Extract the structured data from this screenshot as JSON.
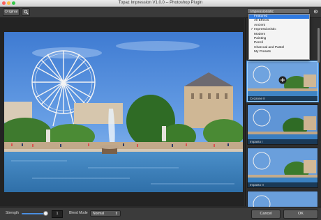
{
  "window": {
    "title": "Topaz Impression V1.0.0 -- Photoshop Plugin"
  },
  "toolbar": {
    "original_label": "Original",
    "zoom_icon": "magnifier-icon"
  },
  "dropdown": {
    "selected": "Impressionistic",
    "items": [
      {
        "label": "Featured",
        "highlighted": true,
        "checked": false
      },
      {
        "label": "All Effects",
        "highlighted": false,
        "checked": false
      },
      {
        "label": "Ancient",
        "highlighted": false,
        "checked": false
      },
      {
        "label": "Impressionistic",
        "highlighted": false,
        "checked": true
      },
      {
        "label": "Modern",
        "highlighted": false,
        "checked": false
      },
      {
        "label": "Painting",
        "highlighted": false,
        "checked": false
      },
      {
        "label": "Pencil",
        "highlighted": false,
        "checked": false
      },
      {
        "label": "Charcoal and Pastel",
        "highlighted": false,
        "checked": false
      },
      {
        "label": "My Presets",
        "highlighted": false,
        "checked": false
      }
    ]
  },
  "presets": [
    {
      "label": "Cezanne II",
      "selected": true
    },
    {
      "label": "Impasto I",
      "selected": false
    },
    {
      "label": "Impasto II",
      "selected": false
    },
    {
      "label": "",
      "selected": false
    }
  ],
  "bottom": {
    "strength_label": "Strength",
    "strength_value": "1",
    "strength_fraction": 0.85,
    "blend_mode_label": "Blend Mode",
    "blend_mode_value": "Normal",
    "cancel_label": "Cancel",
    "ok_label": "OK"
  },
  "colors": {
    "accent": "#2f7ae0",
    "sky": "#4f86d6"
  }
}
